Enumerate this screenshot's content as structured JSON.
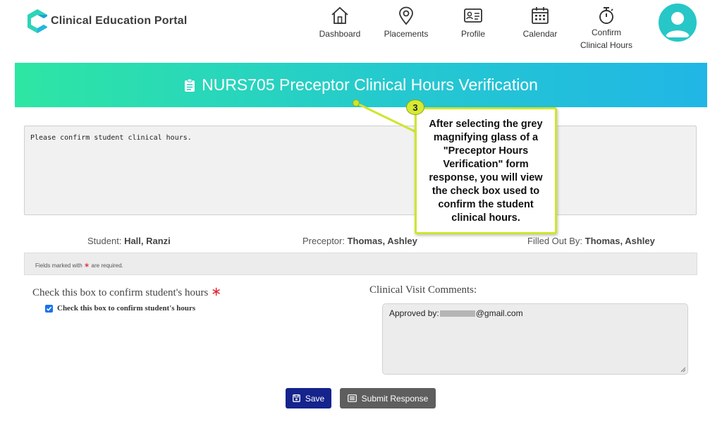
{
  "app": {
    "title": "Clinical Education Portal"
  },
  "nav": [
    {
      "label": "Dashboard",
      "icon": "home-icon"
    },
    {
      "label": "Placements",
      "icon": "map-pin-icon"
    },
    {
      "label": "Profile",
      "icon": "id-card-icon"
    },
    {
      "label": "Calendar",
      "icon": "calendar-icon"
    },
    {
      "label": "Confirm Clinical Hours",
      "line1": "Confirm",
      "line2": "Clinical Hours",
      "icon": "stopwatch-icon"
    }
  ],
  "banner": {
    "title": "NURS705 Preceptor Clinical Hours Verification",
    "icon": "clipboard-icon"
  },
  "message": "Please confirm student clinical hours.",
  "info": {
    "student_label": "Student:",
    "student_value": "Hall, Ranzi",
    "preceptor_label": "Preceptor:",
    "preceptor_value": "Thomas, Ashley",
    "filled_label": "Filled Out By:",
    "filled_value": "Thomas, Ashley"
  },
  "required_note": {
    "prefix": "Fields marked with",
    "suffix": "are required.",
    "star": "∗"
  },
  "confirm": {
    "label": "Check this box to confirm student's hours",
    "checkbox_label": "Check this box to confirm student's hours",
    "checked": true
  },
  "comments": {
    "label": "Clinical Visit Comments:",
    "prefix": "Approved by:",
    "suffix": "@gmail.com"
  },
  "buttons": {
    "save": "Save",
    "submit": "Submit Response"
  },
  "callout": {
    "number": "3",
    "text": "After selecting the grey magnifying glass of a \"Preceptor Hours Verification\" form response, you will view the check box used to confirm the student clinical hours."
  },
  "colors": {
    "banner_start": "#2ee6a3",
    "banner_end": "#21b6e6",
    "save_button": "#15238c",
    "submit_button": "#5e5e5e",
    "required_star": "#e2252f",
    "callout_border": "#cfe52d"
  }
}
